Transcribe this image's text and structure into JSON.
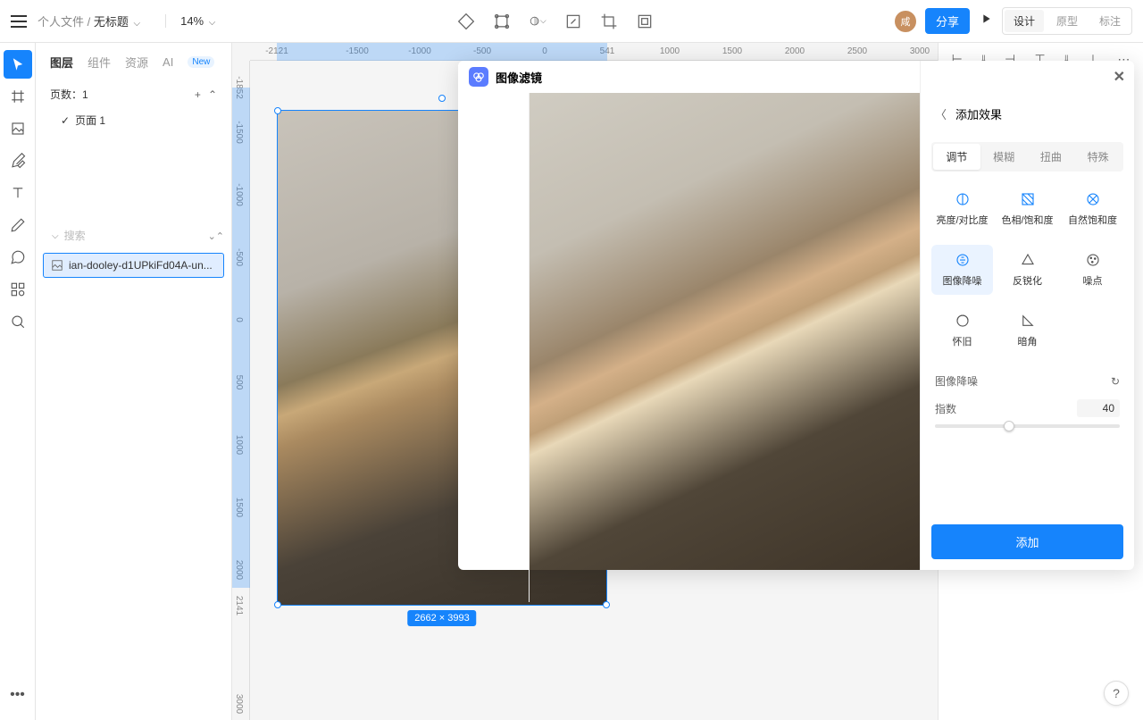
{
  "topbar": {
    "breadcrumb_folder": "个人文件 /",
    "breadcrumb_title": "无标题",
    "zoom": "14%",
    "share_label": "分享",
    "avatar_text": "咸",
    "modes": {
      "design": "设计",
      "prototype": "原型",
      "annotate": "标注"
    }
  },
  "left_panel": {
    "tabs": {
      "layers": "图层",
      "components": "组件",
      "assets": "资源",
      "ai": "AI",
      "new_badge": "New"
    },
    "pages_label": "页数：",
    "pages_count": "1",
    "page_name": "页面 1",
    "search_placeholder": "搜索",
    "layer_name": "ian-dooley-d1UPkiFd04A-un..."
  },
  "canvas": {
    "h_ticks": [
      "-2121",
      "-1500",
      "-1000",
      "-500",
      "0",
      "541",
      "1000",
      "1500",
      "2000",
      "2500",
      "3000"
    ],
    "h_tick_pos": [
      30,
      120,
      190,
      260,
      330,
      400,
      470,
      540,
      610,
      680,
      750
    ],
    "v_ticks": [
      "-1852",
      "-1500",
      "-1000",
      "-500",
      "0",
      "500",
      "1000",
      "1500",
      "2000",
      "2141",
      "3000"
    ],
    "v_tick_pos": [
      30,
      80,
      150,
      220,
      290,
      360,
      430,
      500,
      570,
      610,
      720
    ],
    "selection_dims": "2662 × 3993"
  },
  "filter_popup": {
    "title": "图像滤镜",
    "nav_title": "添加效果",
    "tabs": {
      "adjust": "调节",
      "blur": "模糊",
      "distort": "扭曲",
      "special": "特殊"
    },
    "effects": {
      "brightness": "亮度/对比度",
      "hue": "色相/饱和度",
      "vibrance": "自然饱和度",
      "denoise": "图像降噪",
      "sharpen": "反锐化",
      "noise": "噪点",
      "vintage": "怀旧",
      "vignette": "暗角"
    },
    "param_title": "图像降噪",
    "param_label": "指数",
    "param_value": "40",
    "slider_percent": 40,
    "add_label": "添加"
  },
  "help": "?"
}
